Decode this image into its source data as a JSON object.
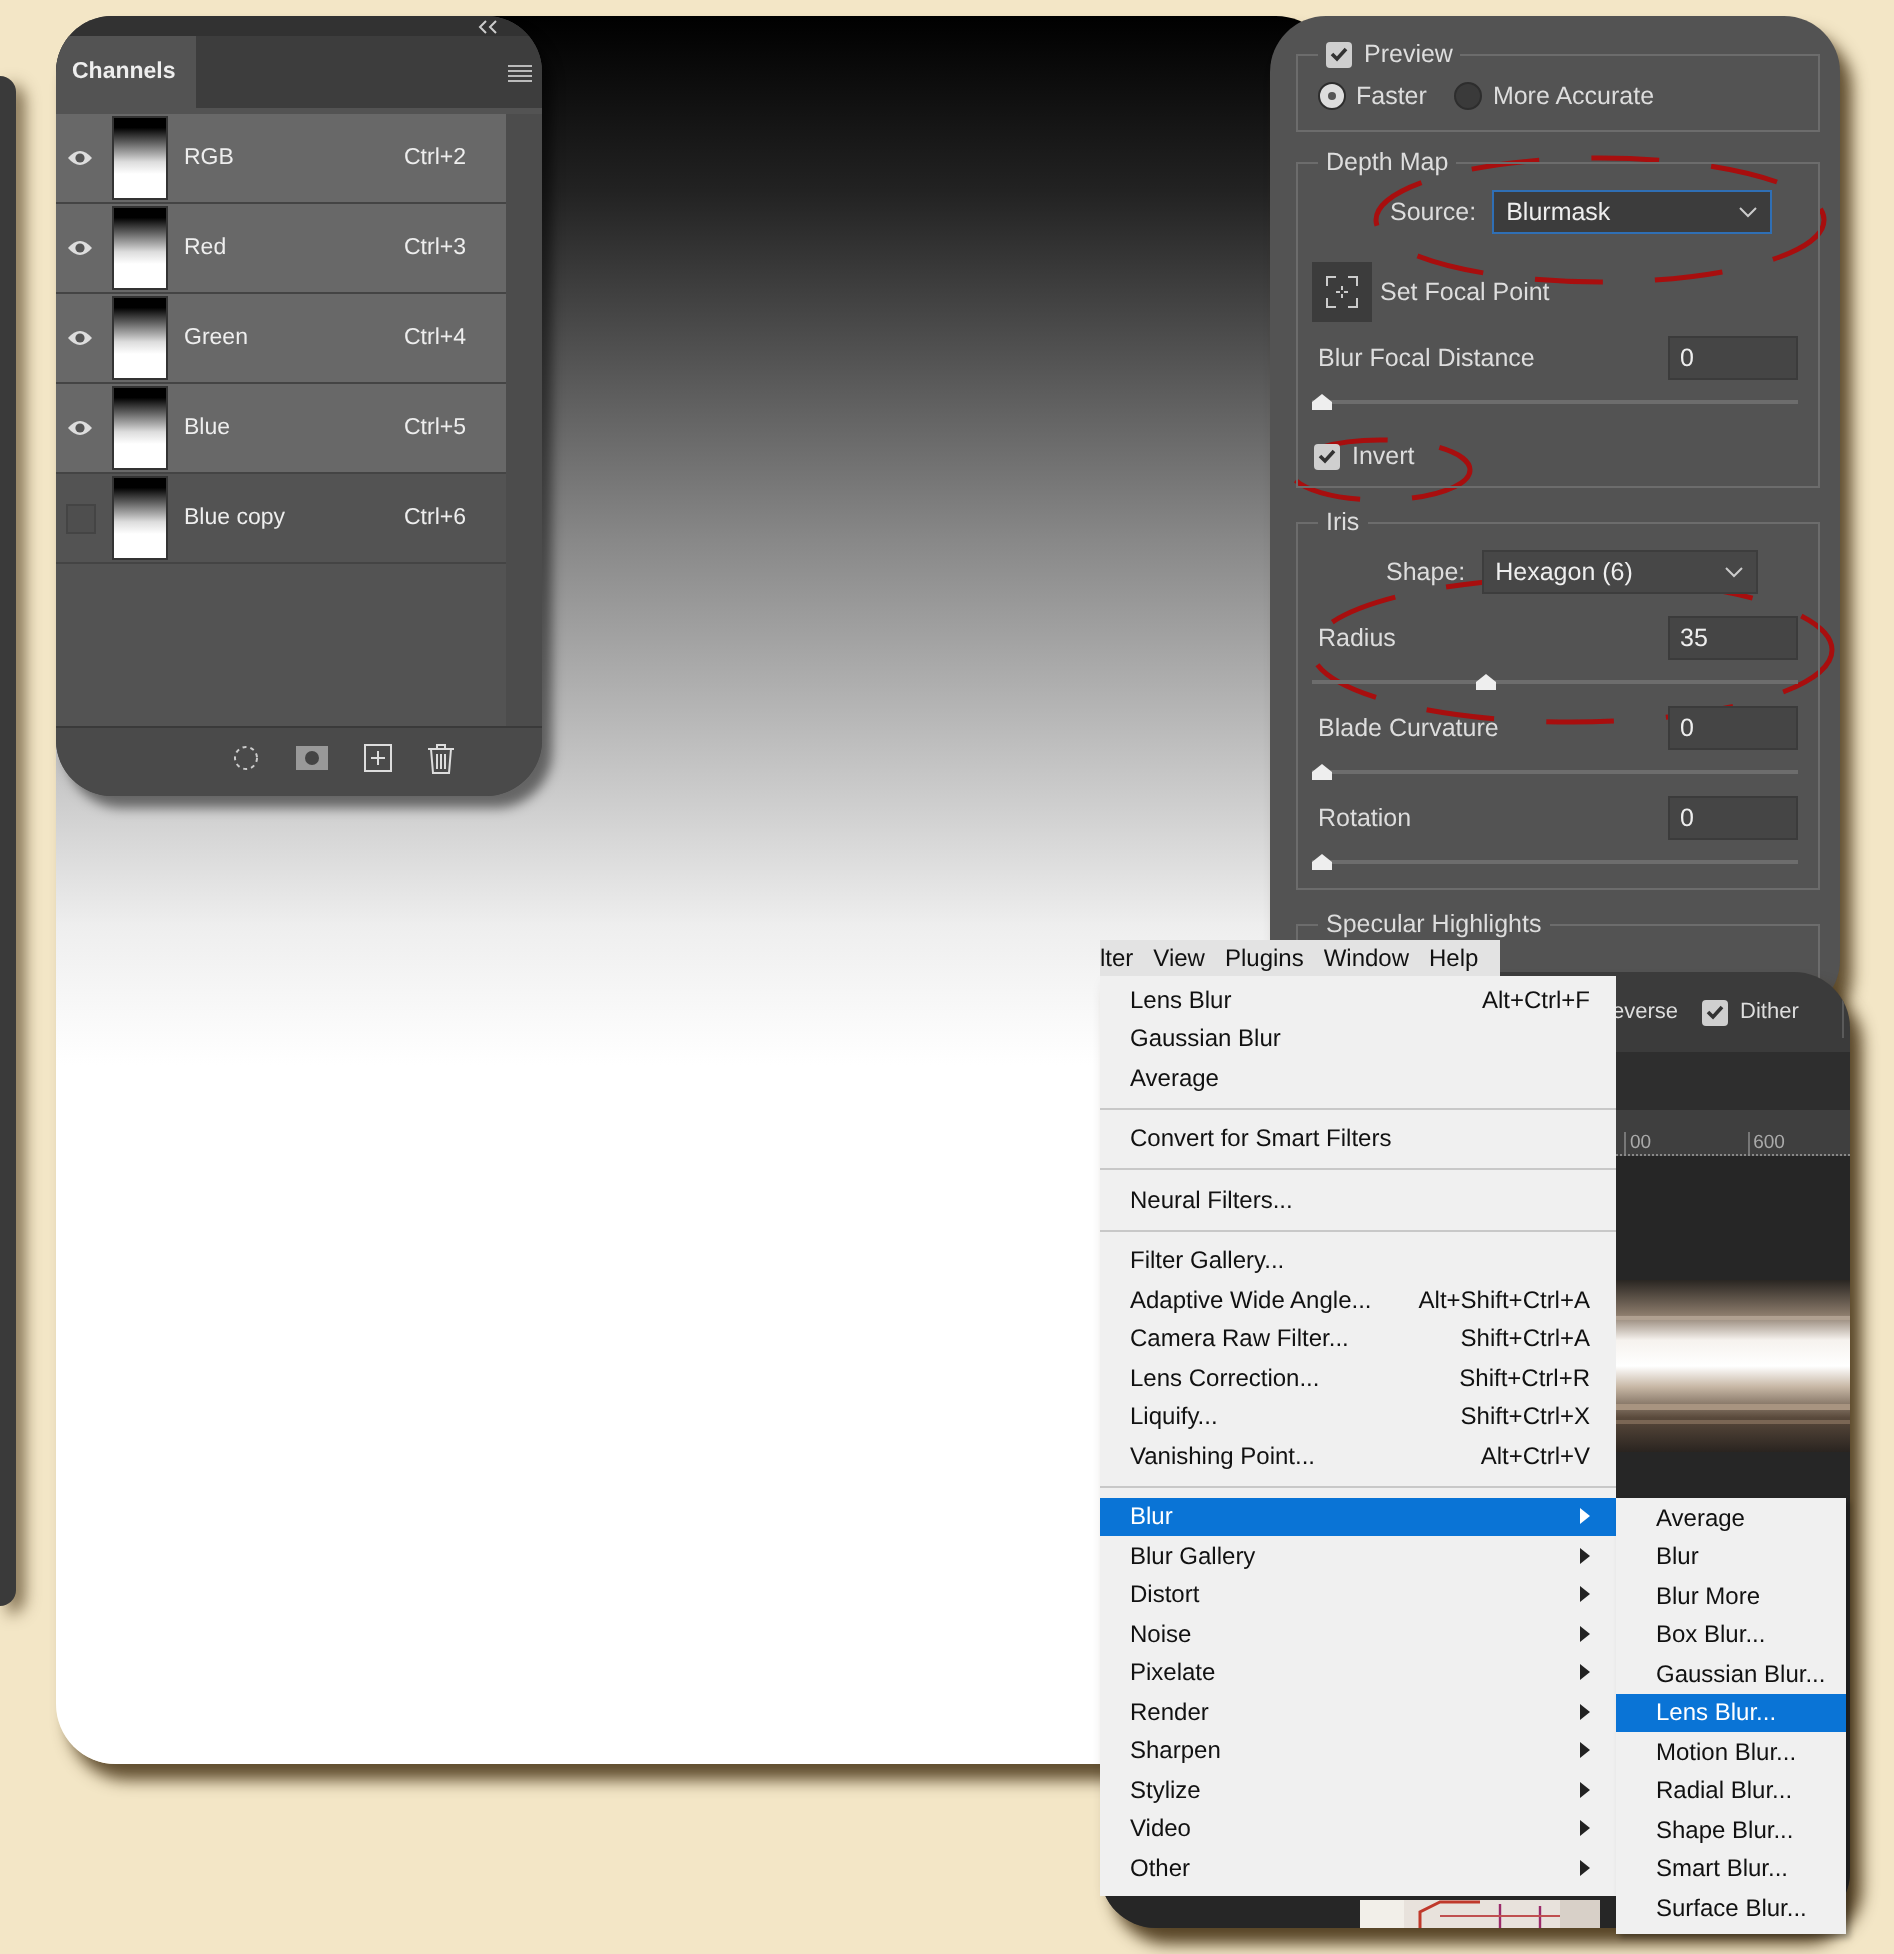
{
  "channels_panel": {
    "title": "Channels",
    "channels": [
      {
        "name": "RGB",
        "shortcut": "Ctrl+2",
        "visible": true,
        "selected": true
      },
      {
        "name": "Red",
        "shortcut": "Ctrl+3",
        "visible": true,
        "selected": true
      },
      {
        "name": "Green",
        "shortcut": "Ctrl+4",
        "visible": true,
        "selected": true
      },
      {
        "name": "Blue",
        "shortcut": "Ctrl+5",
        "visible": true,
        "selected": true
      },
      {
        "name": "Blue copy",
        "shortcut": "Ctrl+6",
        "visible": false,
        "selected": false
      }
    ]
  },
  "lens_blur": {
    "preview": {
      "label": "Preview",
      "checked": true
    },
    "quality": [
      {
        "label": "Faster",
        "selected": true
      },
      {
        "label": "More Accurate",
        "selected": false
      }
    ],
    "depth_map": {
      "title": "Depth Map",
      "source_label": "Source:",
      "source": "Blurmask",
      "focal_button": "Set Focal Point",
      "distance": {
        "label": "Blur Focal Distance",
        "value": "0",
        "level": 0
      },
      "invert": {
        "label": "Invert",
        "checked": true
      }
    },
    "iris": {
      "title": "Iris",
      "shape_label": "Shape:",
      "shape": "Hexagon (6)",
      "sliders": [
        {
          "label": "Radius",
          "value": "35",
          "level": 0.35
        },
        {
          "label": "Blade Curvature",
          "value": "0",
          "level": 0
        },
        {
          "label": "Rotation",
          "value": "0",
          "level": 0
        }
      ]
    },
    "specular_title": "Specular Highlights"
  },
  "menu_bar": [
    "lter",
    "View",
    "Plugins",
    "Window",
    "Help"
  ],
  "options_bar": {
    "reverse_label": "everse",
    "dither": {
      "label": "Dither",
      "checked": true
    }
  },
  "ruler": [
    "00",
    "600"
  ],
  "filter_menu": [
    [
      {
        "label": "Lens Blur",
        "shortcut": "Alt+Ctrl+F",
        "kind": "command",
        "selected": false
      },
      {
        "label": "Gaussian Blur",
        "kind": "command",
        "selected": false
      },
      {
        "label": "Average",
        "kind": "command",
        "selected": false
      }
    ],
    [
      {
        "label": "Convert for Smart Filters",
        "kind": "command",
        "selected": false
      }
    ],
    [
      {
        "label": "Neural Filters...",
        "kind": "command",
        "selected": false
      }
    ],
    [
      {
        "label": "Filter Gallery...",
        "kind": "command",
        "selected": false
      },
      {
        "label": "Adaptive Wide Angle...",
        "shortcut": "Alt+Shift+Ctrl+A",
        "kind": "command",
        "selected": false
      },
      {
        "label": "Camera Raw Filter...",
        "shortcut": "Shift+Ctrl+A",
        "kind": "command",
        "selected": false
      },
      {
        "label": "Lens Correction...",
        "shortcut": "Shift+Ctrl+R",
        "kind": "command",
        "selected": false
      },
      {
        "label": "Liquify...",
        "shortcut": "Shift+Ctrl+X",
        "kind": "command",
        "selected": false
      },
      {
        "label": "Vanishing Point...",
        "shortcut": "Alt+Ctrl+V",
        "kind": "command",
        "selected": false
      }
    ],
    [
      {
        "label": "Blur",
        "kind": "submenu",
        "selected": true
      },
      {
        "label": "Blur Gallery",
        "kind": "submenu",
        "selected": false
      },
      {
        "label": "Distort",
        "kind": "submenu",
        "selected": false
      },
      {
        "label": "Noise",
        "kind": "submenu",
        "selected": false
      },
      {
        "label": "Pixelate",
        "kind": "submenu",
        "selected": false
      },
      {
        "label": "Render",
        "kind": "submenu",
        "selected": false
      },
      {
        "label": "Sharpen",
        "kind": "submenu",
        "selected": false
      },
      {
        "label": "Stylize",
        "kind": "submenu",
        "selected": false
      },
      {
        "label": "Video",
        "kind": "submenu",
        "selected": false
      },
      {
        "label": "Other",
        "kind": "submenu",
        "selected": false
      }
    ]
  ],
  "blur_submenu": [
    {
      "label": "Average",
      "selected": false
    },
    {
      "label": "Blur",
      "selected": false
    },
    {
      "label": "Blur More",
      "selected": false
    },
    {
      "label": "Box Blur...",
      "selected": false
    },
    {
      "label": "Gaussian Blur...",
      "selected": false
    },
    {
      "label": "Lens Blur...",
      "selected": true
    },
    {
      "label": "Motion Blur...",
      "selected": false
    },
    {
      "label": "Radial Blur...",
      "selected": false
    },
    {
      "label": "Shape Blur...",
      "selected": false
    },
    {
      "label": "Smart Blur...",
      "selected": false
    },
    {
      "label": "Surface Blur...",
      "selected": false
    }
  ]
}
